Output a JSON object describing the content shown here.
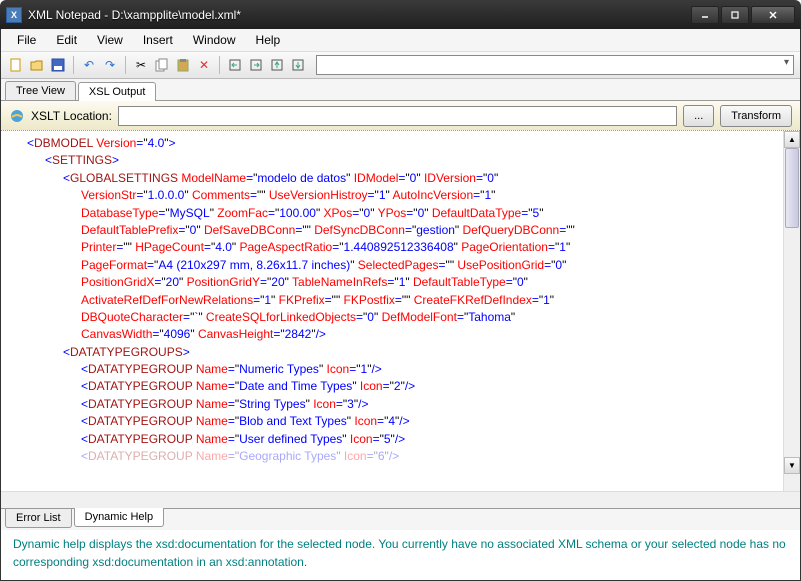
{
  "window": {
    "title": "XML Notepad - D:\\xampplite\\model.xml*"
  },
  "menubar": {
    "items": [
      "File",
      "Edit",
      "View",
      "Insert",
      "Window",
      "Help"
    ]
  },
  "tabs_top": {
    "tab1": "Tree View",
    "tab2": "XSL Output",
    "active": "XSL Output"
  },
  "xslt": {
    "label": "XSLT Location:",
    "location": "",
    "browse": "...",
    "transform": "Transform"
  },
  "xml": {
    "root_tag": "DBMODEL",
    "root_attr_version": "Version",
    "root_val_version": "4.0",
    "settings_tag": "SETTINGS",
    "global_tag": "GLOBALSETTINGS",
    "g_ModelName": "ModelName",
    "g_ModelName_v": "modelo de datos",
    "g_IDModel": "IDModel",
    "g_IDModel_v": "0",
    "g_IDVersion": "IDVersion",
    "g_IDVersion_v": "0",
    "g_VersionStr": "VersionStr",
    "g_VersionStr_v": "1.0.0.0",
    "g_Comments": "Comments",
    "g_Comments_v": "",
    "g_UseVersionHistroy": "UseVersionHistroy",
    "g_UseVersionHistroy_v": "1",
    "g_AutoIncVersion": "AutoIncVersion",
    "g_AutoIncVersion_v": "1",
    "g_DatabaseType": "DatabaseType",
    "g_DatabaseType_v": "MySQL",
    "g_ZoomFac": "ZoomFac",
    "g_ZoomFac_v": "100.00",
    "g_XPos": "XPos",
    "g_XPos_v": "0",
    "g_YPos": "YPos",
    "g_YPos_v": "0",
    "g_DefaultDataType": "DefaultDataType",
    "g_DefaultDataType_v": "5",
    "g_DefaultTablePrefix": "DefaultTablePrefix",
    "g_DefaultTablePrefix_v": "0",
    "g_DefSaveDBConn": "DefSaveDBConn",
    "g_DefSaveDBConn_v": "",
    "g_DefSyncDBConn": "DefSyncDBConn",
    "g_DefSyncDBConn_v": "gestion",
    "g_DefQueryDBConn": "DefQueryDBConn",
    "g_DefQueryDBConn_v": "",
    "g_Printer": "Printer",
    "g_Printer_v": "",
    "g_HPageCount": "HPageCount",
    "g_HPageCount_v": "4.0",
    "g_PageAspectRatio": "PageAspectRatio",
    "g_PageAspectRatio_v": "1.440892512336408",
    "g_PageOrientation": "PageOrientation",
    "g_PageOrientation_v": "1",
    "g_PageFormat": "PageFormat",
    "g_PageFormat_v": "A4 (210x297 mm, 8.26x11.7 inches)",
    "g_SelectedPages": "SelectedPages",
    "g_SelectedPages_v": "",
    "g_UsePositionGrid": "UsePositionGrid",
    "g_UsePositionGrid_v": "0",
    "g_PositionGridX": "PositionGridX",
    "g_PositionGridX_v": "20",
    "g_PositionGridY": "PositionGridY",
    "g_PositionGridY_v": "20",
    "g_TableNameInRefs": "TableNameInRefs",
    "g_TableNameInRefs_v": "1",
    "g_DefaultTableType": "DefaultTableType",
    "g_DefaultTableType_v": "0",
    "g_ActivateRefDefForNewRelations": "ActivateRefDefForNewRelations",
    "g_ActivateRefDefForNewRelations_v": "1",
    "g_FKPrefix": "FKPrefix",
    "g_FKPrefix_v": "",
    "g_FKPostfix": "FKPostfix",
    "g_FKPostfix_v": "",
    "g_CreateFKRefDefIndex": "CreateFKRefDefIndex",
    "g_CreateFKRefDefIndex_v": "1",
    "g_DBQuoteCharacter": "DBQuoteCharacter",
    "g_DBQuoteCharacter_v": "`",
    "g_CreateSQLforLinkedObjects": "CreateSQLforLinkedObjects",
    "g_CreateSQLforLinkedObjects_v": "0",
    "g_DefModelFont": "DefModelFont",
    "g_DefModelFont_v": "Tahoma",
    "g_CanvasWidth": "CanvasWidth",
    "g_CanvasWidth_v": "4096",
    "g_CanvasHeight": "CanvasHeight",
    "g_CanvasHeight_v": "2842",
    "dtgroups_tag": "DATATYPEGROUPS",
    "dtgroup_tag": "DATATYPEGROUP",
    "dtg_Name": "Name",
    "dtg_Icon": "Icon",
    "dtg1_name": "Numeric Types",
    "dtg1_icon": "1",
    "dtg2_name": "Date and Time Types",
    "dtg2_icon": "2",
    "dtg3_name": "String Types",
    "dtg3_icon": "3",
    "dtg4_name": "Blob and Text Types",
    "dtg4_icon": "4",
    "dtg5_name": "User defined Types",
    "dtg5_icon": "5",
    "dtg6_name": "Geographic Types",
    "dtg6_icon": "6"
  },
  "tabs_bottom": {
    "tab1": "Error List",
    "tab2": "Dynamic Help",
    "active": "Dynamic Help"
  },
  "help_text": "Dynamic help displays the xsd:documentation for the selected node. You currently have no associated XML schema or your selected node has no corresponding xsd:documentation in an xsd:annotation."
}
